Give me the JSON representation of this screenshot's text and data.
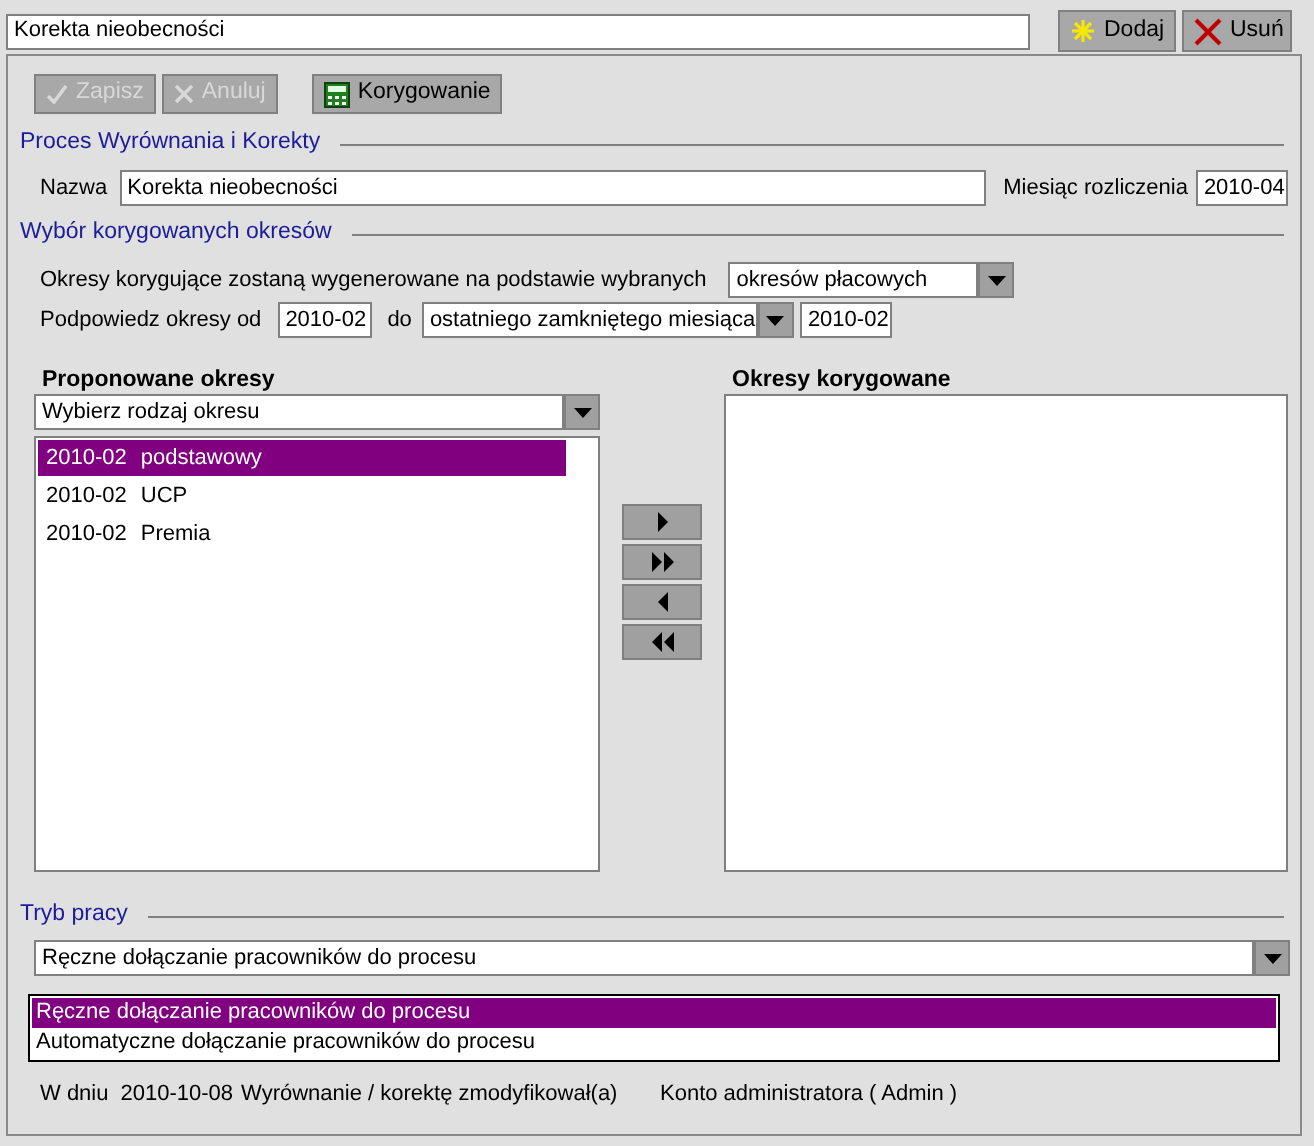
{
  "header": {
    "name_value": "Korekta nieobecności",
    "buttons": [
      {
        "label": "Dodaj",
        "kind": "add"
      },
      {
        "label": "Usuń",
        "kind": "delete"
      }
    ]
  },
  "toolbar": [
    {
      "label": "Zapisz",
      "kind": "save",
      "disabled": true
    },
    {
      "label": "Anuluj",
      "kind": "cancel",
      "disabled": true
    },
    {
      "label": "Korygowanie",
      "kind": "calculator",
      "disabled": false
    }
  ],
  "process_section": {
    "title": "Proces Wyrównania i Korekty",
    "name_label": "Nazwa",
    "name_value": "Korekta nieobecności",
    "month_label": "Miesiąc rozliczenia",
    "month_value": "2010-04"
  },
  "periods_section": {
    "title": "Wybór korygowanych okresów",
    "basis_label": "Okresy korygujące zostaną wygenerowane na podstawie wybranych",
    "basis_value": "okresów płacowych",
    "from_label": "Podpowiedz okresy od",
    "from_value": "2010-02",
    "to_label": "do",
    "to_value": "ostatniego zamkniętego miesiąca",
    "to_date": "2010-02"
  },
  "proposed": {
    "title": "Proponowane okresy",
    "filter_value": "Wybierz rodzaj okresu",
    "items": [
      {
        "date": "2010-02",
        "type": "podstawowy",
        "selected": true
      },
      {
        "date": "2010-02",
        "type": "UCP",
        "selected": false
      },
      {
        "date": "2010-02",
        "type": "Premia",
        "selected": false
      }
    ]
  },
  "transfer_buttons": [
    {
      "kind": "move_right"
    },
    {
      "kind": "move_all_right"
    },
    {
      "kind": "move_left"
    },
    {
      "kind": "move_all_left"
    }
  ],
  "corrected": {
    "title": "Okresy korygowane"
  },
  "work_mode": {
    "title": "Tryb pracy",
    "value": "Ręczne dołączanie pracowników do procesu",
    "options": [
      {
        "label": "Ręczne dołączanie pracowników do procesu",
        "selected": true
      },
      {
        "label": "Automatyczne dołączanie pracowników do procesu",
        "selected": false
      }
    ]
  },
  "info_rows": [
    {
      "prefix": "W dniu",
      "date": "2010-10-08",
      "action": "Wyrównanie / korektę zmodyfikował(a)",
      "user": "Konto administratora ( Admin )"
    }
  ]
}
